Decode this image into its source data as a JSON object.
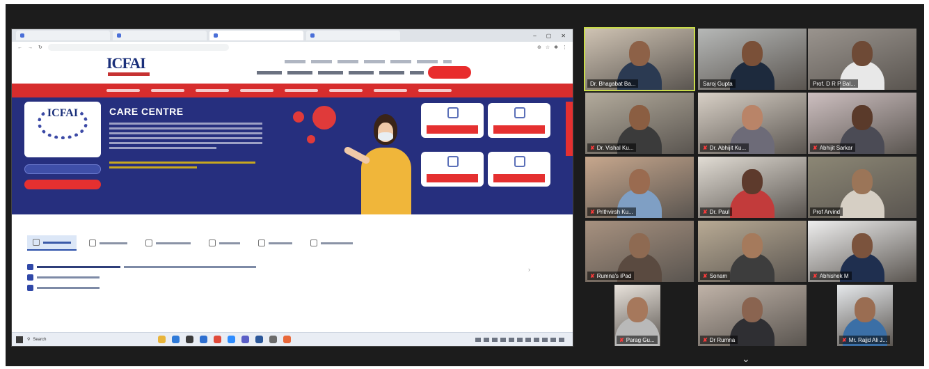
{
  "colors": {
    "meeting_bg": "#1c1c1c",
    "active_speaker_border": "#c9dc4a",
    "brand_red": "#d72d2d",
    "brand_navy": "#262f7e",
    "muted_mic": "#ff3b3b"
  },
  "shared_screen": {
    "site": {
      "logo_text": "ICFAI",
      "hero_title": "CARE CENTRE"
    },
    "services": [
      {
        "icon": "blood-plasma-icon"
      },
      {
        "icon": "hospital-bed-icon"
      },
      {
        "icon": "oxygen-cylinder-icon"
      },
      {
        "icon": "ambulance-icon"
      }
    ],
    "content_tabs": [
      {
        "icon": "first-aid-icon",
        "active": true
      },
      {
        "icon": "medical-care-icon",
        "active": false
      },
      {
        "icon": "medical-supplies-icon",
        "active": false
      },
      {
        "icon": "helpline-icon",
        "active": false
      },
      {
        "icon": "ambulance-icon",
        "active": false
      },
      {
        "icon": "covid-guide-icon",
        "active": false
      }
    ],
    "taskbar": {
      "search_label": "Search",
      "apps": [
        "file-explorer-icon",
        "edge-icon",
        "store-icon",
        "mail-icon",
        "chrome-icon",
        "zoom-icon",
        "teams-icon",
        "word-icon",
        "settings-icon",
        "photos-icon"
      ]
    }
  },
  "participants": [
    {
      "name": "Dr. Bhagabat Ba...",
      "muted": false,
      "active_speaker": true,
      "skin": "#8d6147",
      "shirt": "#2b3a52",
      "room": "#cfc3b3"
    },
    {
      "name": "Saroj Gupta",
      "muted": false,
      "active_speaker": false,
      "skin": "#7a5038",
      "shirt": "#1d2a3d",
      "room": "#b6b8b7"
    },
    {
      "name": "Prof. D R P Bal...",
      "muted": false,
      "active_speaker": false,
      "skin": "#6e4a36",
      "shirt": "#e8e8e8",
      "room": "#9a948e"
    },
    {
      "name": "Dr. Vishal Ku...",
      "muted": true,
      "active_speaker": false,
      "skin": "#8b5e42",
      "shirt": "#3b3b3b",
      "room": "#b3ab9c"
    },
    {
      "name": "Dr. Abhijit Ku...",
      "muted": true,
      "active_speaker": false,
      "skin": "#b98468",
      "shirt": "#6d6b78",
      "room": "#d8d0c6"
    },
    {
      "name": "Abhijit Sarkar",
      "muted": true,
      "active_speaker": false,
      "skin": "#5a3a2a",
      "shirt": "#4b4b55",
      "room": "#cdbfc0"
    },
    {
      "name": "Prithvirsh Ku...",
      "muted": true,
      "active_speaker": false,
      "skin": "#9a6b50",
      "shirt": "#7f9fc4",
      "room": "#c7a78d"
    },
    {
      "name": "Dr. Paul",
      "muted": true,
      "active_speaker": false,
      "skin": "#5d3a2c",
      "shirt": "#c23b3b",
      "room": "#e1dcd4"
    },
    {
      "name": "Prof Arvind",
      "muted": false,
      "active_speaker": false,
      "skin": "#9b7558",
      "shirt": "#d6cfc4",
      "room": "#8c8775"
    },
    {
      "name": "Rumna's iPad",
      "muted": true,
      "active_speaker": false,
      "skin": "#8e6a52",
      "shirt": "#5a4a40",
      "room": "#a7917f"
    },
    {
      "name": "Sonam",
      "muted": true,
      "active_speaker": false,
      "skin": "#a57a5c",
      "shirt": "#3d3d3d",
      "room": "#b8aa94"
    },
    {
      "name": "Abhishek M",
      "muted": true,
      "active_speaker": false,
      "skin": "#7b533d",
      "shirt": "#1f2f4f",
      "room": "#eeeeee"
    },
    {
      "name": "Parag Gu...",
      "muted": true,
      "active_speaker": false,
      "skin": "#a6785c",
      "shirt": "#b9b9b9",
      "room": "#e9e3dc"
    },
    {
      "name": "Dr Rumna",
      "muted": true,
      "active_speaker": false,
      "skin": "#8a6450",
      "shirt": "#2f2f33",
      "room": "#c0b3a8"
    },
    {
      "name": "Mr. Rajjd Ali J...",
      "muted": true,
      "active_speaker": false,
      "skin": "#9a6d52",
      "shirt": "#3b6fa6",
      "room": "#e6e9ec"
    }
  ]
}
